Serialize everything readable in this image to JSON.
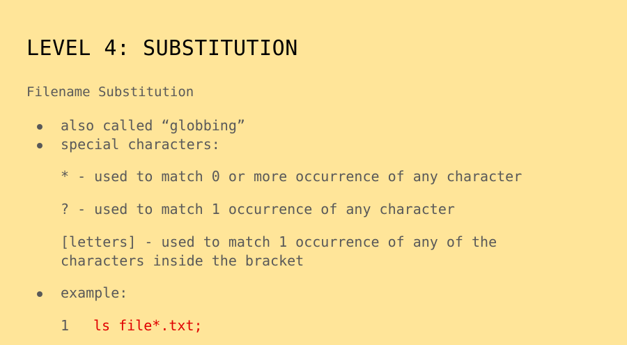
{
  "slide": {
    "title": "LEVEL 4: SUBSTITUTION",
    "subtitle": "Filename Substitution",
    "bullets": [
      {
        "text": "also called “globbing”"
      },
      {
        "text": "special characters:"
      }
    ],
    "special_chars": [
      {
        "text": "* - used to match 0 or more occurrence of any character"
      },
      {
        "text": "? - used to match 1 occurrence of any character"
      },
      {
        "line1": "[letters] - used to match 1 occurrence of any of the",
        "line2": "characters inside the bracket"
      }
    ],
    "example_bullet": "example:",
    "code": {
      "line_number": "1",
      "code_text": "ls file*.txt;"
    }
  }
}
